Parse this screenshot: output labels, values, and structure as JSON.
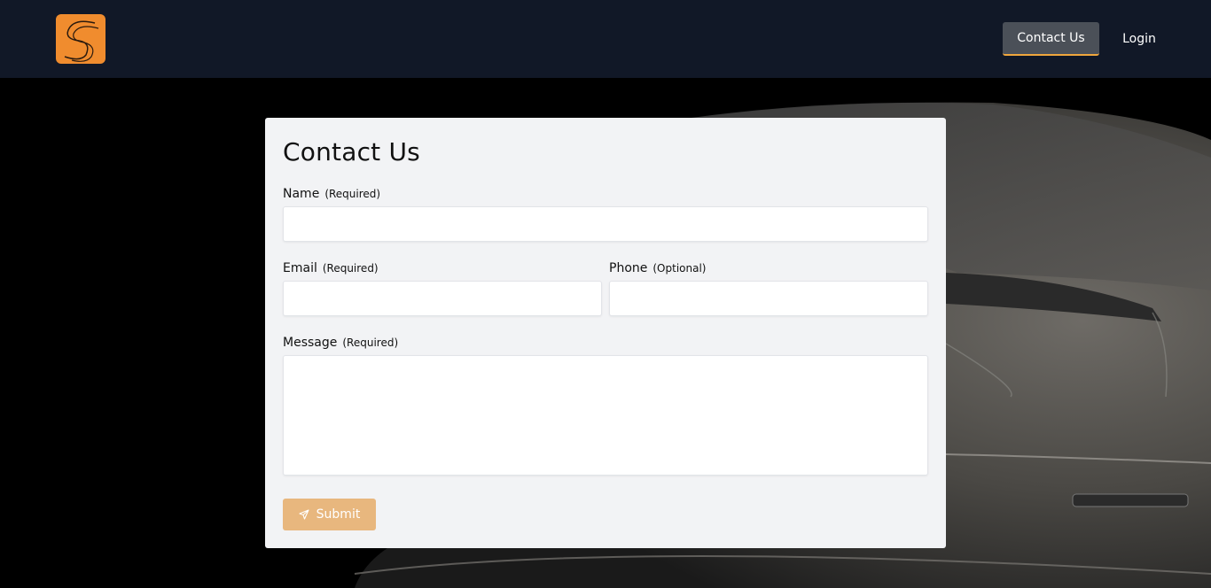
{
  "navbar": {
    "logo_icon": "s-curve-logo",
    "contact_label": "Contact Us",
    "login_label": "Login"
  },
  "form": {
    "title": "Contact Us",
    "name": {
      "label": "Name",
      "hint": "(Required)",
      "value": ""
    },
    "email": {
      "label": "Email",
      "hint": "(Required)",
      "value": ""
    },
    "phone": {
      "label": "Phone",
      "hint": "(Optional)",
      "value": ""
    },
    "message": {
      "label": "Message",
      "hint": "(Required)",
      "value": ""
    },
    "submit_label": "Submit",
    "submit_icon": "paper-plane-icon"
  },
  "colors": {
    "navbar_bg": "#111827",
    "accent": "#f08c2e",
    "submit_bg": "#e8b77e",
    "card_bg": "#f2f3f5"
  }
}
